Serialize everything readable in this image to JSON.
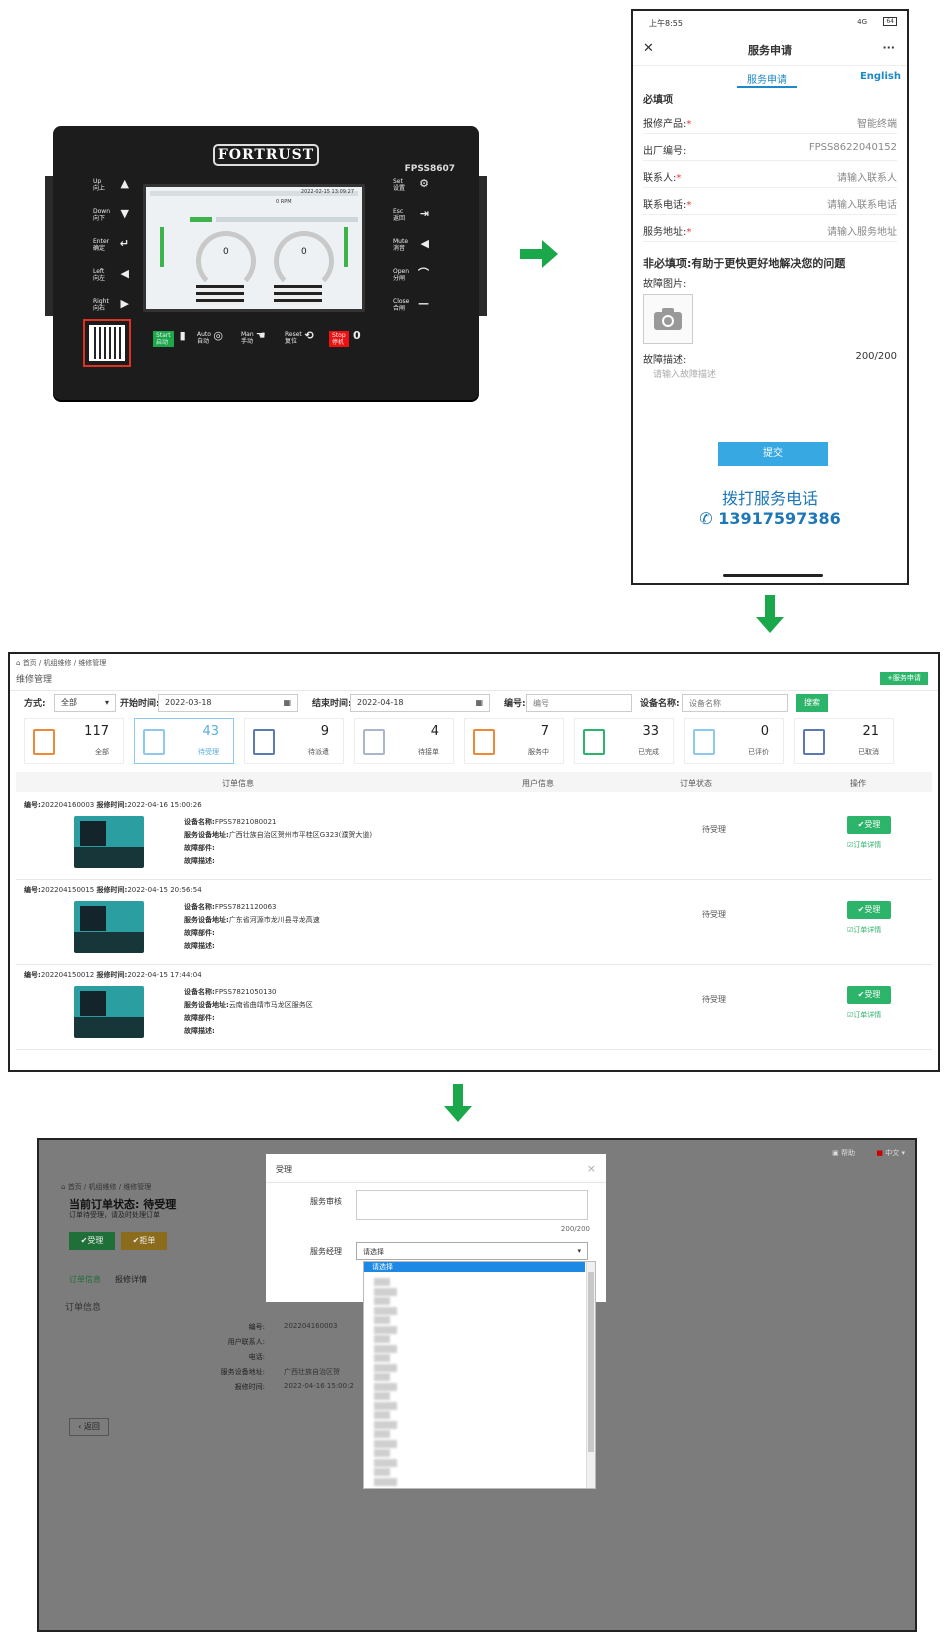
{
  "controller": {
    "brand": "FORTRUST",
    "model": "FPSS8607",
    "gauge_left_value": "0",
    "gauge_right_value": "0",
    "lcd_rpm_label": "0 RPM",
    "lcd_date": "2022-02-15 13:09:27",
    "keys_left": [
      {
        "en": "Up",
        "cn": "向上",
        "glyph": "▲"
      },
      {
        "en": "Down",
        "cn": "向下",
        "glyph": "▼"
      },
      {
        "en": "Enter",
        "cn": "确定",
        "glyph": "↵"
      },
      {
        "en": "Left",
        "cn": "向左",
        "glyph": "◀"
      },
      {
        "en": "Right",
        "cn": "向右",
        "glyph": "▶"
      }
    ],
    "keys_right": [
      {
        "en": "Set",
        "cn": "设置",
        "glyph": "⚙"
      },
      {
        "en": "Esc",
        "cn": "返回",
        "glyph": "⇥"
      },
      {
        "en": "Mute",
        "cn": "消音",
        "glyph": "◀"
      },
      {
        "en": "Open",
        "cn": "分闸",
        "glyph": "⌒"
      },
      {
        "en": "Close",
        "cn": "合闸",
        "glyph": "—"
      }
    ],
    "keys_bottom": [
      {
        "en": "Start",
        "cn": "启动",
        "glyph": "▮"
      },
      {
        "en": "Auto",
        "cn": "自动",
        "glyph": "◎"
      },
      {
        "en": "Man",
        "cn": "手动",
        "glyph": "☚"
      },
      {
        "en": "Reset",
        "cn": "复位",
        "glyph": "⟲"
      },
      {
        "en": "Stop",
        "cn": "停机",
        "glyph": "0"
      }
    ]
  },
  "phone": {
    "time": "上午8:55",
    "signal": "4G",
    "battery": "64",
    "title": "服务申请",
    "more": "···",
    "tab_active": "服务申请",
    "tab_lang": "English",
    "required_heading": "必填项",
    "fields": [
      {
        "label": "报修产品:",
        "required": true,
        "value": "智能终端"
      },
      {
        "label": "出厂编号:",
        "required": false,
        "value": "FPSS8622040152"
      },
      {
        "label": "联系人:",
        "required": true,
        "value": "请输入联系人"
      },
      {
        "label": "联系电话:",
        "required": true,
        "value": "请输入联系电话"
      },
      {
        "label": "服务地址:",
        "required": true,
        "value": "请输入服务地址"
      }
    ],
    "optional_heading": "非必填项:有助于更快更好地解决您的问题",
    "photo_label": "故障图片:",
    "desc_label": "故障描述:",
    "desc_count": "200/200",
    "desc_placeholder": "请输入故障描述",
    "submit": "提交",
    "call_text": "拨打服务电话",
    "phone_number": "13917597386"
  },
  "admin": {
    "breadcrumb": [
      "首页",
      "机组维修",
      "维修管理"
    ],
    "page_title": "维修管理",
    "new_button": "+服务申请",
    "filters": {
      "mode_label": "方式:",
      "mode_value": "全部",
      "start_label": "开始时间:",
      "start_value": "2022-03-18",
      "end_label": "结束时间:",
      "end_value": "2022-04-18",
      "code_label": "编号:",
      "code_placeholder": "编号",
      "device_label": "设备名称:",
      "device_placeholder": "设备名称",
      "search": "搜索"
    },
    "stats": [
      {
        "count": "117",
        "label": "全部",
        "color": "#f0883a"
      },
      {
        "count": "43",
        "label": "待受理",
        "color": "#8ec8ec"
      },
      {
        "count": "9",
        "label": "待派遣",
        "color": "#5a7ab0"
      },
      {
        "count": "4",
        "label": "待接单",
        "color": "#a9b6cc"
      },
      {
        "count": "7",
        "label": "服务中",
        "color": "#f0883a"
      },
      {
        "count": "33",
        "label": "已完成",
        "color": "#2cb46a"
      },
      {
        "count": "0",
        "label": "已评价",
        "color": "#8ec8ec"
      },
      {
        "count": "21",
        "label": "已取消",
        "color": "#5a7ab0"
      }
    ],
    "columns": [
      "订单信息",
      "用户信息",
      "订单状态",
      "操作"
    ],
    "orders": [
      {
        "id_label": "编号:",
        "id": "202204160003",
        "time_label": "报修时间:",
        "time": "2022-04-16 15:00:26",
        "device": "FPSS7821080021",
        "address": "广西壮族自治区贺州市平桂区G323(濮贺大道)",
        "status": "待受理"
      },
      {
        "id_label": "编号:",
        "id": "202204150015",
        "time_label": "报修时间:",
        "time": "2022-04-15 20:56:54",
        "device": "FPSS7821120063",
        "address": "广东省河源市龙川县寻龙高速",
        "status": "待受理"
      },
      {
        "id_label": "编号:",
        "id": "202204150012",
        "time_label": "报修时间:",
        "time": "2022-04-15 17:44:04",
        "device": "FPSS7821050130",
        "address": "云南省曲靖市马龙区服务区",
        "status": "待受理"
      }
    ],
    "info_labels": {
      "device": "设备名称:",
      "address": "服务设备地址:",
      "part": "故障部件:",
      "desc": "故障描述:"
    },
    "accept_btn": "✔受理",
    "detail_link": "订单详情"
  },
  "screen3": {
    "help": "帮助",
    "lang": "中文",
    "breadcrumb": [
      "首页",
      "机组维修",
      "维修管理"
    ],
    "status_title": "当前订单状态: 待受理",
    "status_sub": "订单待受理，请及时处理订单",
    "accept_btn": "✔受理",
    "reject_btn": "✔拒单",
    "tabs": [
      "订单信息",
      "报修详情"
    ],
    "section": "订单信息",
    "detail_rows": [
      {
        "label": "编号:",
        "value": "202204160003"
      },
      {
        "label": "用户联系人:",
        "value": ""
      },
      {
        "label": "电话:",
        "value": ""
      },
      {
        "label": "服务设备地址:",
        "value": "广西壮族自治区贺"
      },
      {
        "label": "报修时间:",
        "value": "2022-04-16 15:00:2"
      }
    ],
    "back": "返回",
    "modal": {
      "title": "受理",
      "close": "×",
      "review_label": "服务审核",
      "counter": "200/200",
      "manager_label": "服务经理",
      "select_value": "请选择",
      "option_selected": "请选择"
    }
  }
}
